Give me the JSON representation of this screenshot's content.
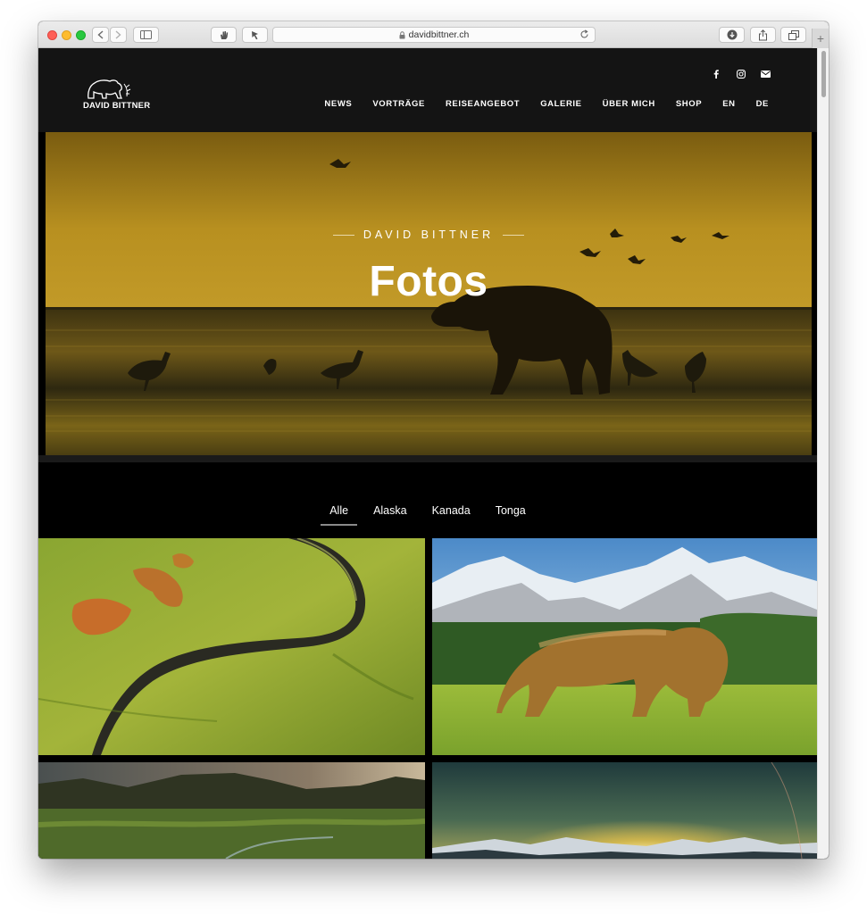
{
  "browser": {
    "url": "davidbittner.ch"
  },
  "site": {
    "logo_text": "DAVID BITTNER",
    "social_icons": [
      "facebook-icon",
      "instagram-icon",
      "mail-icon"
    ],
    "nav": [
      {
        "label": "NEWS"
      },
      {
        "label": "VORTRÄGE"
      },
      {
        "label": "REISEANGEBOT"
      },
      {
        "label": "GALERIE"
      },
      {
        "label": "ÜBER MICH"
      },
      {
        "label": "SHOP"
      },
      {
        "label": "EN"
      },
      {
        "label": "DE"
      }
    ]
  },
  "hero": {
    "eyebrow": "DAVID BITTNER",
    "title": "Fotos"
  },
  "filters": [
    {
      "label": "Alle",
      "active": true
    },
    {
      "label": "Alaska",
      "active": false
    },
    {
      "label": "Kanada",
      "active": false
    },
    {
      "label": "Tonga",
      "active": false
    }
  ],
  "colors": {
    "header_bg": "#141414",
    "hero_gold": "#b68d1e",
    "page_bg": "#000000"
  }
}
